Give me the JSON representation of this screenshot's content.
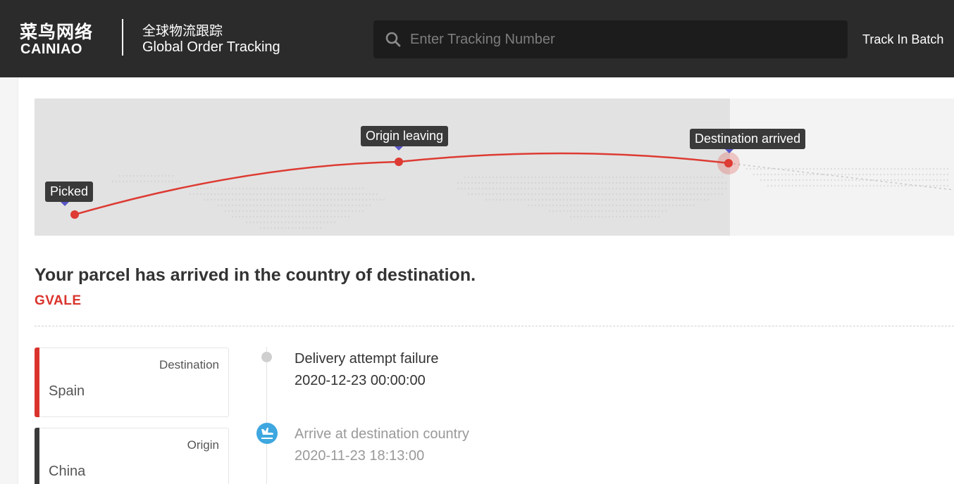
{
  "header": {
    "logo_cn": "菜鸟网络",
    "logo_en": "CAINIAO",
    "subtitle_cn": "全球物流跟踪",
    "subtitle_en": "Global Order Tracking",
    "search_placeholder": "Enter Tracking Number",
    "search_value": "",
    "search_icon": "search-icon",
    "batch_label": "Track In Batch"
  },
  "map": {
    "nodes": [
      {
        "label": "Picked",
        "state": "done"
      },
      {
        "label": "Origin leaving",
        "state": "done"
      },
      {
        "label": "Destination arrived",
        "state": "current"
      }
    ],
    "route_color": "#dd3b33",
    "pointer_color": "#5a55c6"
  },
  "status": {
    "title": "Your parcel has arrived in the country of destination.",
    "tracking_number": "GVALE"
  },
  "cards": [
    {
      "label": "Destination",
      "value": "Spain",
      "accent": "#d9332c"
    },
    {
      "label": "Origin",
      "value": "China",
      "accent": "#3a3a3a"
    }
  ],
  "events": [
    {
      "title": "Delivery attempt failure",
      "time": "2020-12-23 00:00:00",
      "icon": "dot-icon"
    },
    {
      "title": "Arrive at destination country",
      "time": "2020-11-23 18:13:00",
      "icon": "plane-landing-icon"
    }
  ]
}
